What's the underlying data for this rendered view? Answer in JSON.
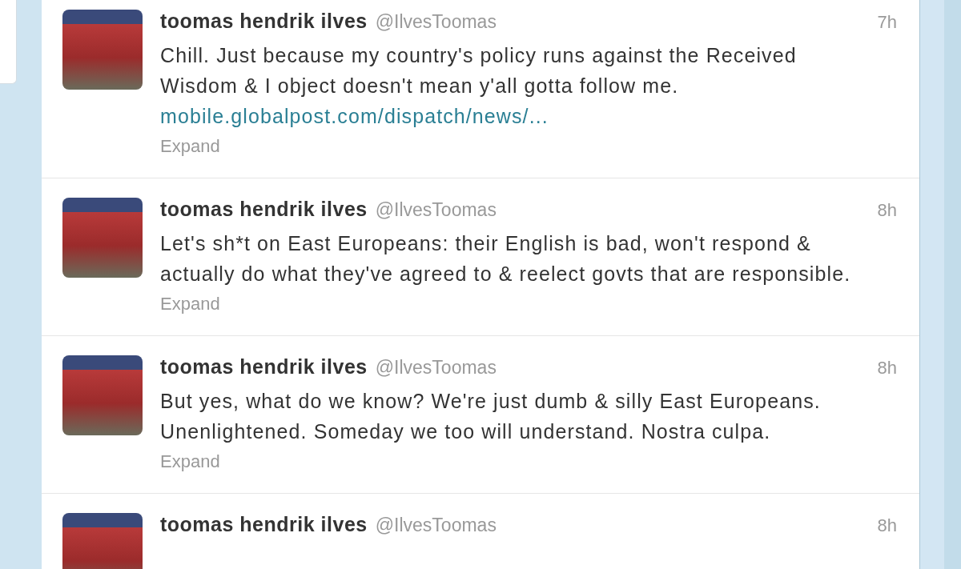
{
  "tweets": [
    {
      "name": "toomas hendrik ilves",
      "handle": "@IlvesToomas",
      "time": "7h",
      "text": "Chill. Just because my country's policy runs against the Received Wisdom & I object doesn't mean y'all gotta follow me.",
      "link": "mobile.globalpost.com/dispatch/news/...",
      "action": "Expand"
    },
    {
      "name": "toomas hendrik ilves",
      "handle": "@IlvesToomas",
      "time": "8h",
      "text": "Let's sh*t on East Europeans: their English is bad, won't respond & actually do what they've agreed to & reelect govts that are responsible.",
      "action": "Expand"
    },
    {
      "name": "toomas hendrik ilves",
      "handle": "@IlvesToomas",
      "time": "8h",
      "text": "But yes, what do we know? We're just dumb & silly East Europeans. Unenlightened. Someday we too will understand. Nostra culpa.",
      "action": "Expand"
    },
    {
      "name": "toomas hendrik ilves",
      "handle": "@IlvesToomas",
      "time": "8h"
    }
  ]
}
